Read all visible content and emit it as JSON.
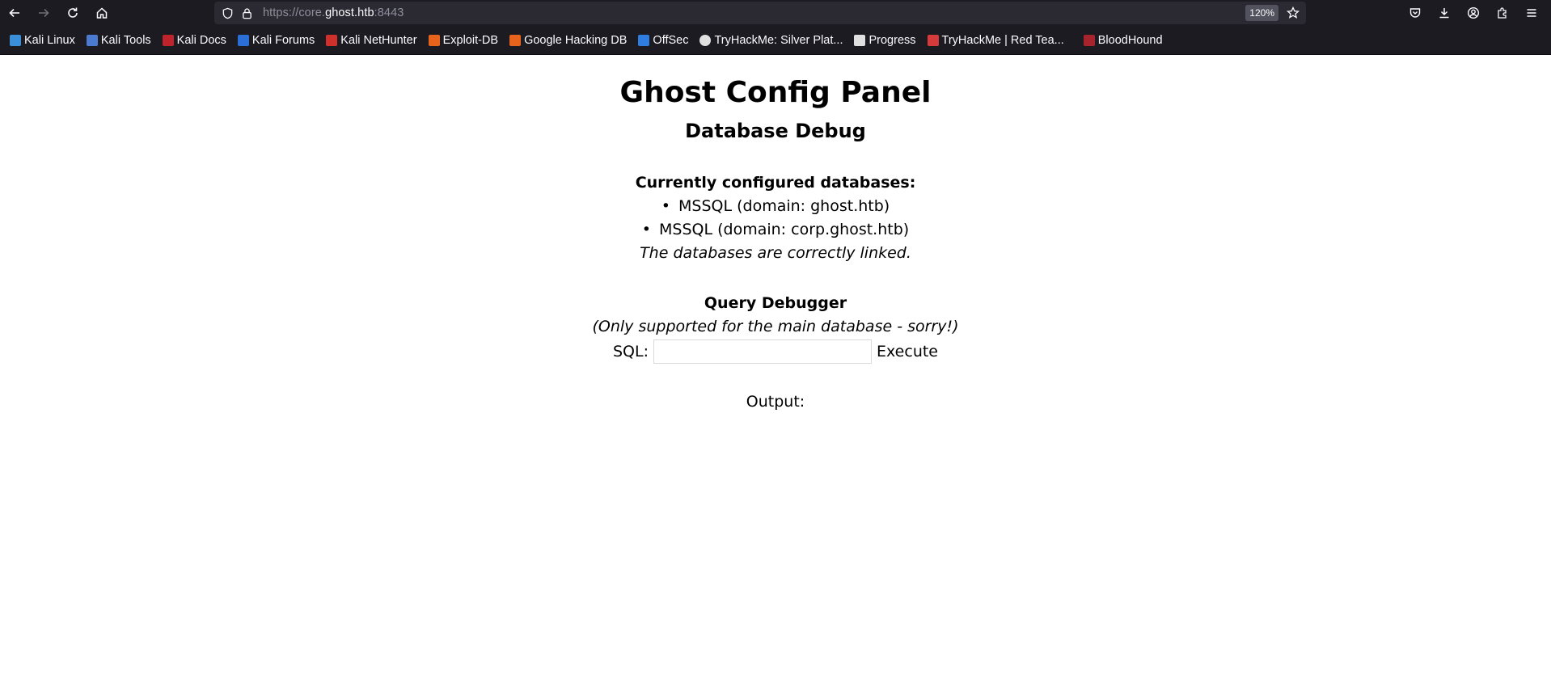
{
  "browser": {
    "url_prefix": "https://core.",
    "url_host": "ghost.htb",
    "url_port": ":8443",
    "zoom": "120%",
    "bookmarks": [
      {
        "label": "Kali Linux",
        "color": "#3a8fd8"
      },
      {
        "label": "Kali Tools",
        "color": "#4a7bd0"
      },
      {
        "label": "Kali Docs",
        "color": "#c0232c"
      },
      {
        "label": "Kali Forums",
        "color": "#2b6fd6"
      },
      {
        "label": "Kali NetHunter",
        "color": "#d0302c"
      },
      {
        "label": "Exploit-DB",
        "color": "#e8641c"
      },
      {
        "label": "Google Hacking DB",
        "color": "#e8641c"
      },
      {
        "label": "OffSec",
        "color": "#2f7de0"
      },
      {
        "label": "TryHackMe: Silver Plat...",
        "color": "#e0e0e0"
      },
      {
        "label": "Progress",
        "color": "#e0e0e0"
      },
      {
        "label": "TryHackMe | Red Tea...",
        "color": "#d63a3a"
      },
      {
        "label": "BloodHound",
        "color": "#a8242c"
      }
    ]
  },
  "page": {
    "title": "Ghost Config Panel",
    "subtitle": "Database Debug",
    "databases_heading": "Currently configured databases:",
    "databases": [
      "MSSQL (domain: ghost.htb)",
      "MSSQL (domain: corp.ghost.htb)"
    ],
    "databases_note": "The databases are correctly linked.",
    "query_heading": "Query Debugger",
    "query_note": "(Only supported for the main database - sorry!)",
    "sql_label": "SQL:",
    "sql_value": "",
    "execute_label": "Execute",
    "output_label": "Output:"
  }
}
